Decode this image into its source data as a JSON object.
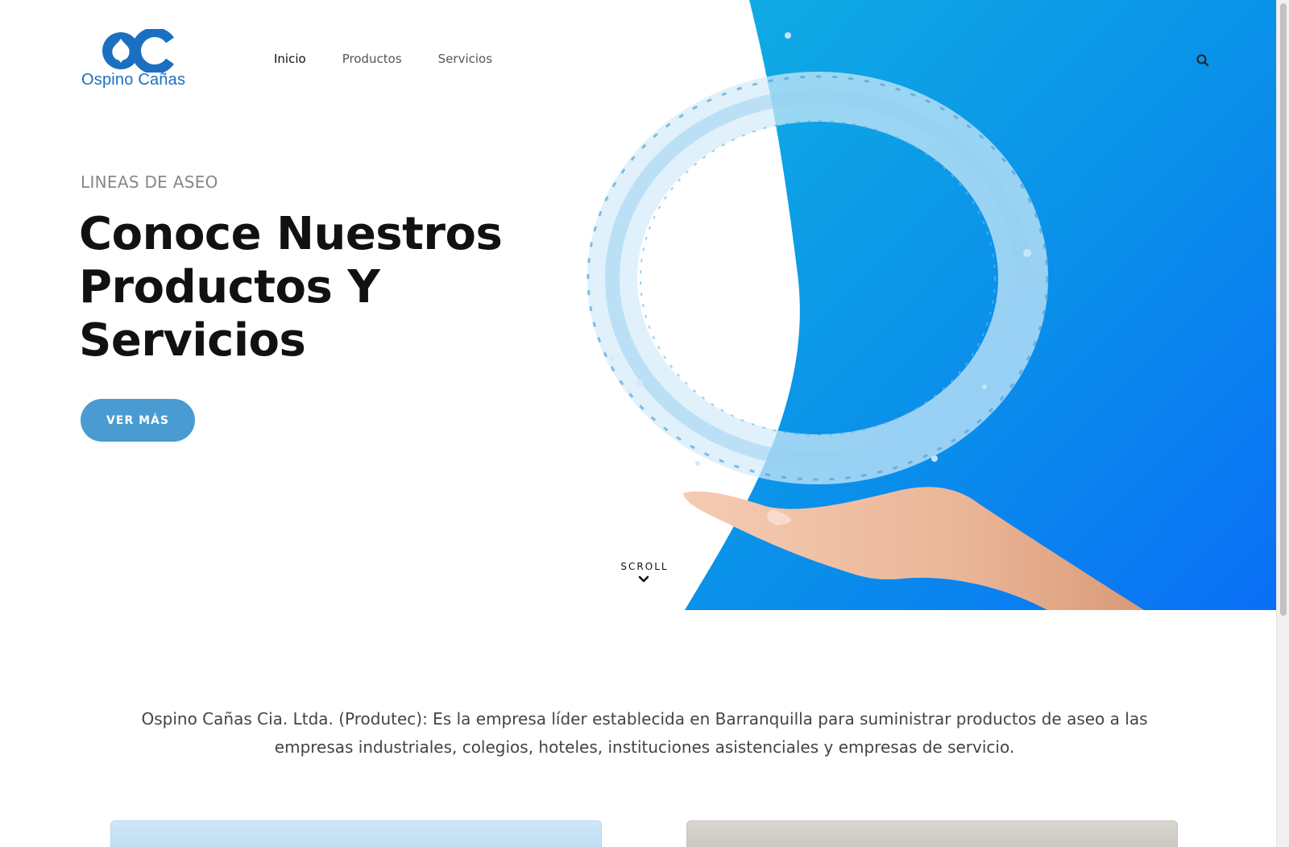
{
  "brand": {
    "name": "Ospino Cañas",
    "accent_color": "#1b6fc1"
  },
  "nav": {
    "items": [
      {
        "label": "Inicio",
        "active": true
      },
      {
        "label": "Productos",
        "active": false
      },
      {
        "label": "Servicios",
        "active": false
      }
    ],
    "search_icon": "search-icon"
  },
  "hero": {
    "eyebrow": "LINEAS DE ASEO",
    "headline_line1": "Conoce Nuestros",
    "headline_line2": "Productos Y",
    "headline_line3": "Servicios",
    "cta_label": "VER MÁS",
    "cta_color": "#4a9bd1",
    "scroll_label": "SCROLL",
    "scroll_icon": "chevron-down-icon",
    "gradient_colors": [
      "#0fa7e2",
      "#0a72f0"
    ]
  },
  "intro": {
    "text": "Ospino Cañas Cia. Ltda. (Produtec): Es la empresa líder establecida en Barranquilla para suministrar productos de aseo a las empresas industriales, colegios, hoteles, instituciones asistenciales y empresas de servicio."
  }
}
